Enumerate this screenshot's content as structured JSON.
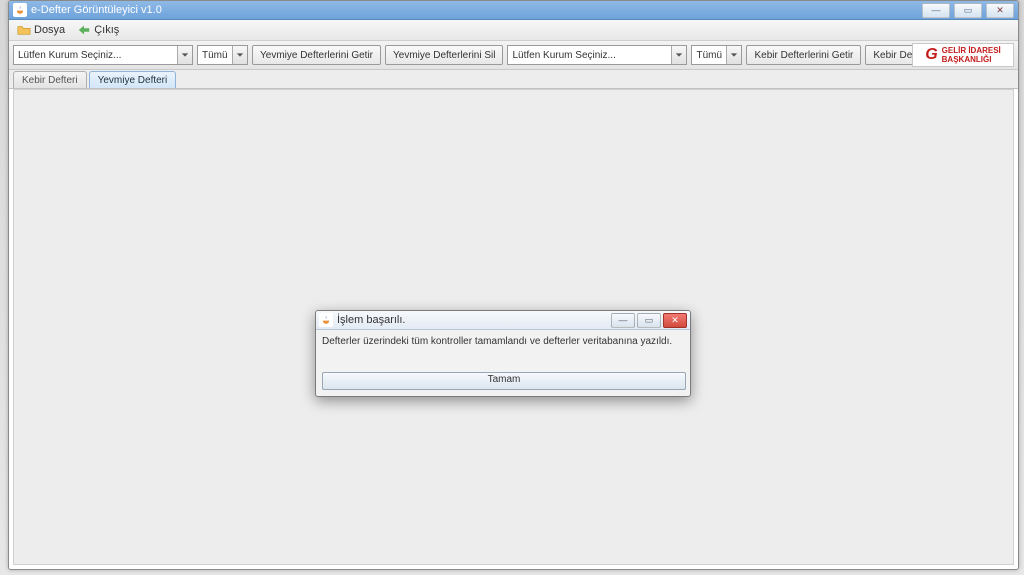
{
  "window": {
    "title": "e-Defter Görüntüleyici v1.0",
    "ghost_menu": [
      "",
      "",
      "",
      ""
    ],
    "controls": {
      "minimize": "—",
      "maximize": "▭",
      "close": "✕"
    }
  },
  "menubar": {
    "file": "Dosya",
    "exit": "Çıkış"
  },
  "toolbar": {
    "combo_kurum_placeholder": "Lütfen Kurum Seçiniz...",
    "combo_all": "Tümü",
    "btn_yev_getir": "Yevmiye Defterlerini Getir",
    "btn_yev_sil": "Yevmiye Defterlerini Sil",
    "btn_kebir_getir": "Kebir Defterlerini Getir",
    "btn_kebir_sil": "Kebir Defterlerini Sil"
  },
  "brand": {
    "line1": "GELİR İDARESİ",
    "line2": "BAŞKANLIĞI"
  },
  "tabs": {
    "kebir": "Kebir Defteri",
    "yevmiye": "Yevmiye Defteri"
  },
  "dialog": {
    "title": "İşlem başarılı.",
    "message": "Defterler üzerindeki tüm kontroller tamamlandı ve defterler veritabanına yazıldı.",
    "ok": "Tamam",
    "controls": {
      "minimize": "—",
      "maximize": "▭",
      "close": "✕"
    }
  }
}
